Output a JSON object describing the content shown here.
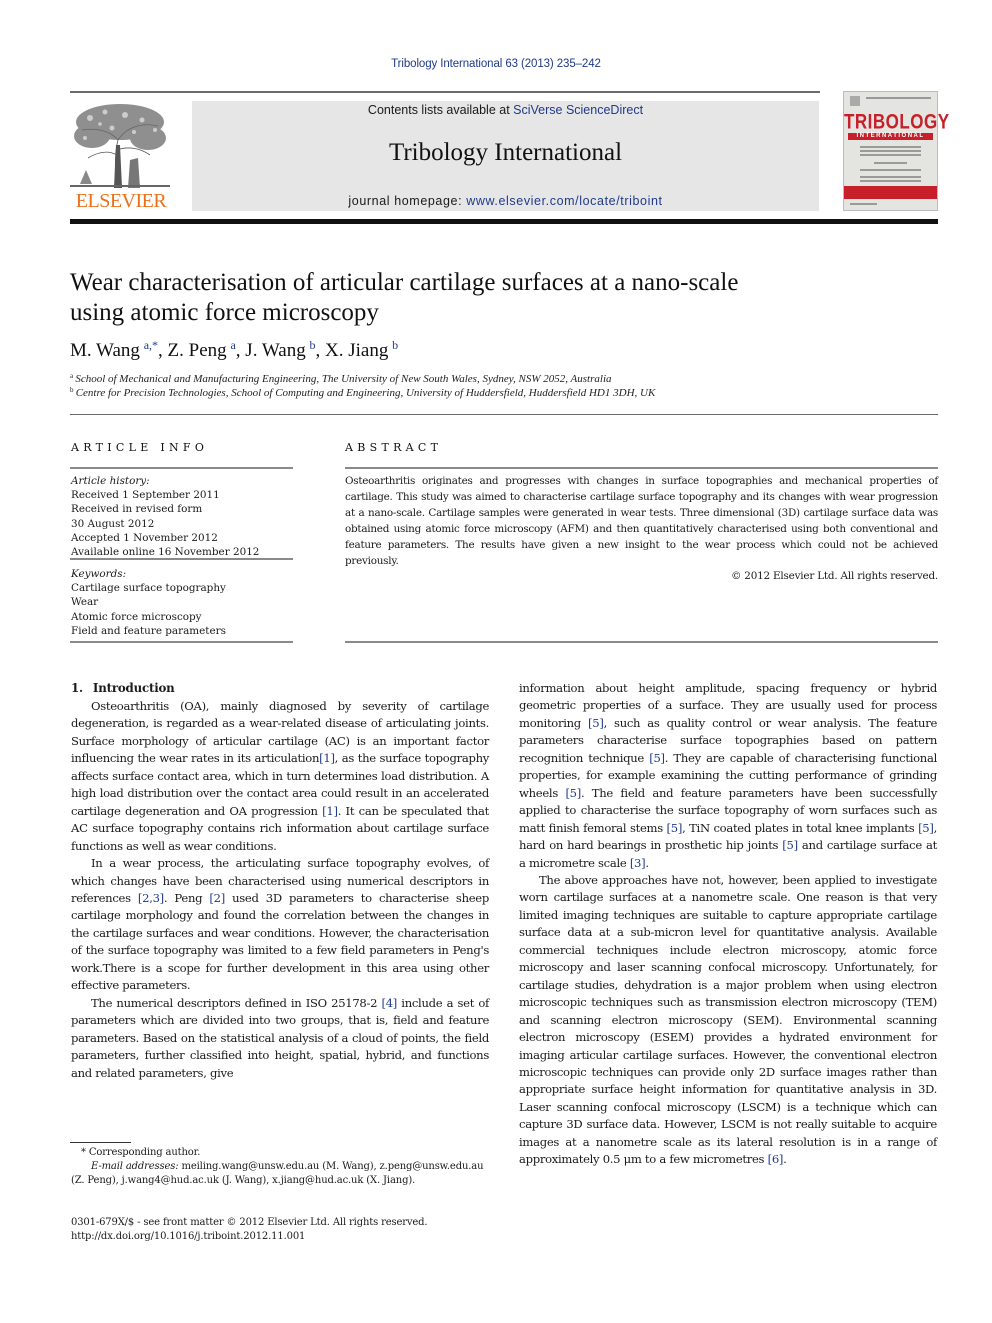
{
  "header": {
    "journal_ref": "Tribology International 63 (2013) 235–242",
    "contents_prefix": "Contents lists available at ",
    "contents_link": "SciVerse ScienceDirect",
    "journal_title": "Tribology International",
    "homepage_prefix": "journal homepage: ",
    "homepage_link": "www.elsevier.com/locate/triboint",
    "publisher_logo": "ELSEVIER",
    "cover_title": "TRIBOLOGY",
    "cover_subtitle": "INTERNATIONAL",
    "colors": {
      "link": "#1f3a8a",
      "elsevier_orange": "#e9711c",
      "cover_red": "#c8202a",
      "banner_bg": "#e6e6e6"
    }
  },
  "article": {
    "title_line1": "Wear characterisation of articular cartilage surfaces at a nano-scale",
    "title_line2": "using atomic force microscopy",
    "authors": [
      {
        "name": "M. Wang",
        "sup": "a,*",
        "sep": ", "
      },
      {
        "name": "Z. Peng",
        "sup": "a",
        "sep": ", "
      },
      {
        "name": "J. Wang",
        "sup": "b",
        "sep": ", "
      },
      {
        "name": "X. Jiang",
        "sup": "b",
        "sep": ""
      }
    ],
    "affiliations": [
      {
        "label": "a",
        "text": "School of Mechanical and Manufacturing Engineering, The University of New South Wales, Sydney, NSW 2052, Australia"
      },
      {
        "label": "b",
        "text": "Centre for Precision Technologies, School of Computing and Engineering, University of Huddersfield, Huddersfield HD1 3DH, UK"
      }
    ]
  },
  "article_info": {
    "heading": "ARTICLE INFO",
    "history_label": "Article history:",
    "history": [
      "Received 1 September 2011",
      "Received in revised form",
      "30 August 2012",
      "Accepted 1 November 2012",
      "Available online 16 November 2012"
    ],
    "keywords_label": "Keywords:",
    "keywords": [
      "Cartilage surface topography",
      "Wear",
      "Atomic force microscopy",
      "Field and feature parameters"
    ]
  },
  "abstract": {
    "heading": "ABSTRACT",
    "text": "Osteoarthritis originates and progresses with changes in surface topographies and mechanical properties of cartilage. This study was aimed to characterise cartilage surface topography and its changes with wear progression at a nano-scale. Cartilage samples were generated in wear tests. Three dimensional (3D) cartilage surface data was obtained using atomic force microscopy (AFM) and then quantitatively characterised using both conventional and feature parameters. The results have given a new insight to the wear process which could not be achieved previously.",
    "copyright": "© 2012 Elsevier Ltd. All rights reserved."
  },
  "body": {
    "section_number": "1.",
    "section_title": "Introduction",
    "left_paragraphs": [
      [
        {
          "t": "Osteoarthritis (OA), mainly diagnosed by severity of cartilage degeneration, is regarded as a wear-related disease of articulating joints. Surface morphology of articular cartilage (AC) is an important factor influencing the wear rates in its articulation"
        },
        {
          "r": "[1]"
        },
        {
          "t": ", as the surface topography affects surface contact area, which in turn determines load distribution. A high load distribution over the contact area could result in an accelerated cartilage degeneration and OA progression "
        },
        {
          "r": "[1]"
        },
        {
          "t": ". It can be speculated that AC surface topography contains rich information about cartilage surface functions as well as wear conditions."
        }
      ],
      [
        {
          "t": "In a wear process, the articulating surface topography evolves, of which changes have been characterised using numerical descriptors in references "
        },
        {
          "r": "[2,3]"
        },
        {
          "t": ". Peng "
        },
        {
          "r": "[2]"
        },
        {
          "t": " used 3D parameters to characterise sheep cartilage morphology and found the correlation between the changes in the cartilage surfaces and wear conditions. However, the characterisation of the surface topography was limited to a few field parameters in Peng's work.There is a scope for further development in this area using other effective parameters."
        }
      ],
      [
        {
          "t": "The numerical descriptors defined in ISO 25178-2 "
        },
        {
          "r": "[4]"
        },
        {
          "t": " include a set of parameters which are divided into two groups, that is, field and feature parameters. Based on the statistical analysis of a cloud of points, the field parameters, further classified into height, spatial, hybrid, and functions and related parameters, give"
        }
      ]
    ],
    "right_paragraphs": [
      [
        {
          "t": "information about height amplitude, spacing frequency or hybrid geometric properties of a surface. They are usually used for process monitoring "
        },
        {
          "r": "[5]"
        },
        {
          "t": ", such as quality control or wear analysis. The feature parameters characterise surface topographies based on pattern recognition technique "
        },
        {
          "r": "[5]"
        },
        {
          "t": ". They are capable of characterising functional properties, for example examining the cutting performance of grinding wheels "
        },
        {
          "r": "[5]"
        },
        {
          "t": ". The field and feature parameters have been successfully applied to characterise the surface topography of worn surfaces such as matt finish femoral stems "
        },
        {
          "r": "[5]"
        },
        {
          "t": ", TiN coated plates in total knee implants "
        },
        {
          "r": "[5]"
        },
        {
          "t": ", hard on hard bearings in prosthetic hip joints "
        },
        {
          "r": "[5]"
        },
        {
          "t": " and cartilage surface at a micrometre scale "
        },
        {
          "r": "[3]"
        },
        {
          "t": "."
        }
      ],
      [
        {
          "t": "The above approaches have not, however, been applied to investigate worn cartilage surfaces at a nanometre scale. One reason is that very limited imaging techniques are suitable to capture appropriate cartilage surface data at a sub-micron level for quantitative analysis. Available commercial techniques include electron microscopy, atomic force microscopy and laser scanning confocal microscopy. Unfortunately, for cartilage studies, dehydration is a major problem when using electron microscopic techniques such as transmission electron microscopy (TEM) and scanning electron microscopy (SEM). Environmental scanning electron microscopy (ESEM) provides a hydrated environment for imaging articular cartilage surfaces. However, the conventional electron microscopic techniques can provide only 2D surface images rather than appropriate surface height information for quantitative analysis in 3D. Laser scanning confocal microscopy (LSCM) is a technique which can capture 3D surface data. However, LSCM is not really suitable to acquire images at a nanometre scale as its lateral resolution is in a range of approximately 0.5 μm to a few micrometres "
        },
        {
          "r": "[6]"
        },
        {
          "t": "."
        }
      ]
    ]
  },
  "footnotes": {
    "corresponding": "* Corresponding author.",
    "email_label": "E-mail addresses:",
    "emails": "meiling.wang@unsw.edu.au (M. Wang), z.peng@unsw.edu.au (Z. Peng), j.wang4@hud.ac.uk (J. Wang), x.jiang@hud.ac.uk (X. Jiang).",
    "issn": "0301-679X/$ - see front matter © 2012 Elsevier Ltd. All rights reserved.",
    "doi": "http://dx.doi.org/10.1016/j.triboint.2012.11.001"
  }
}
